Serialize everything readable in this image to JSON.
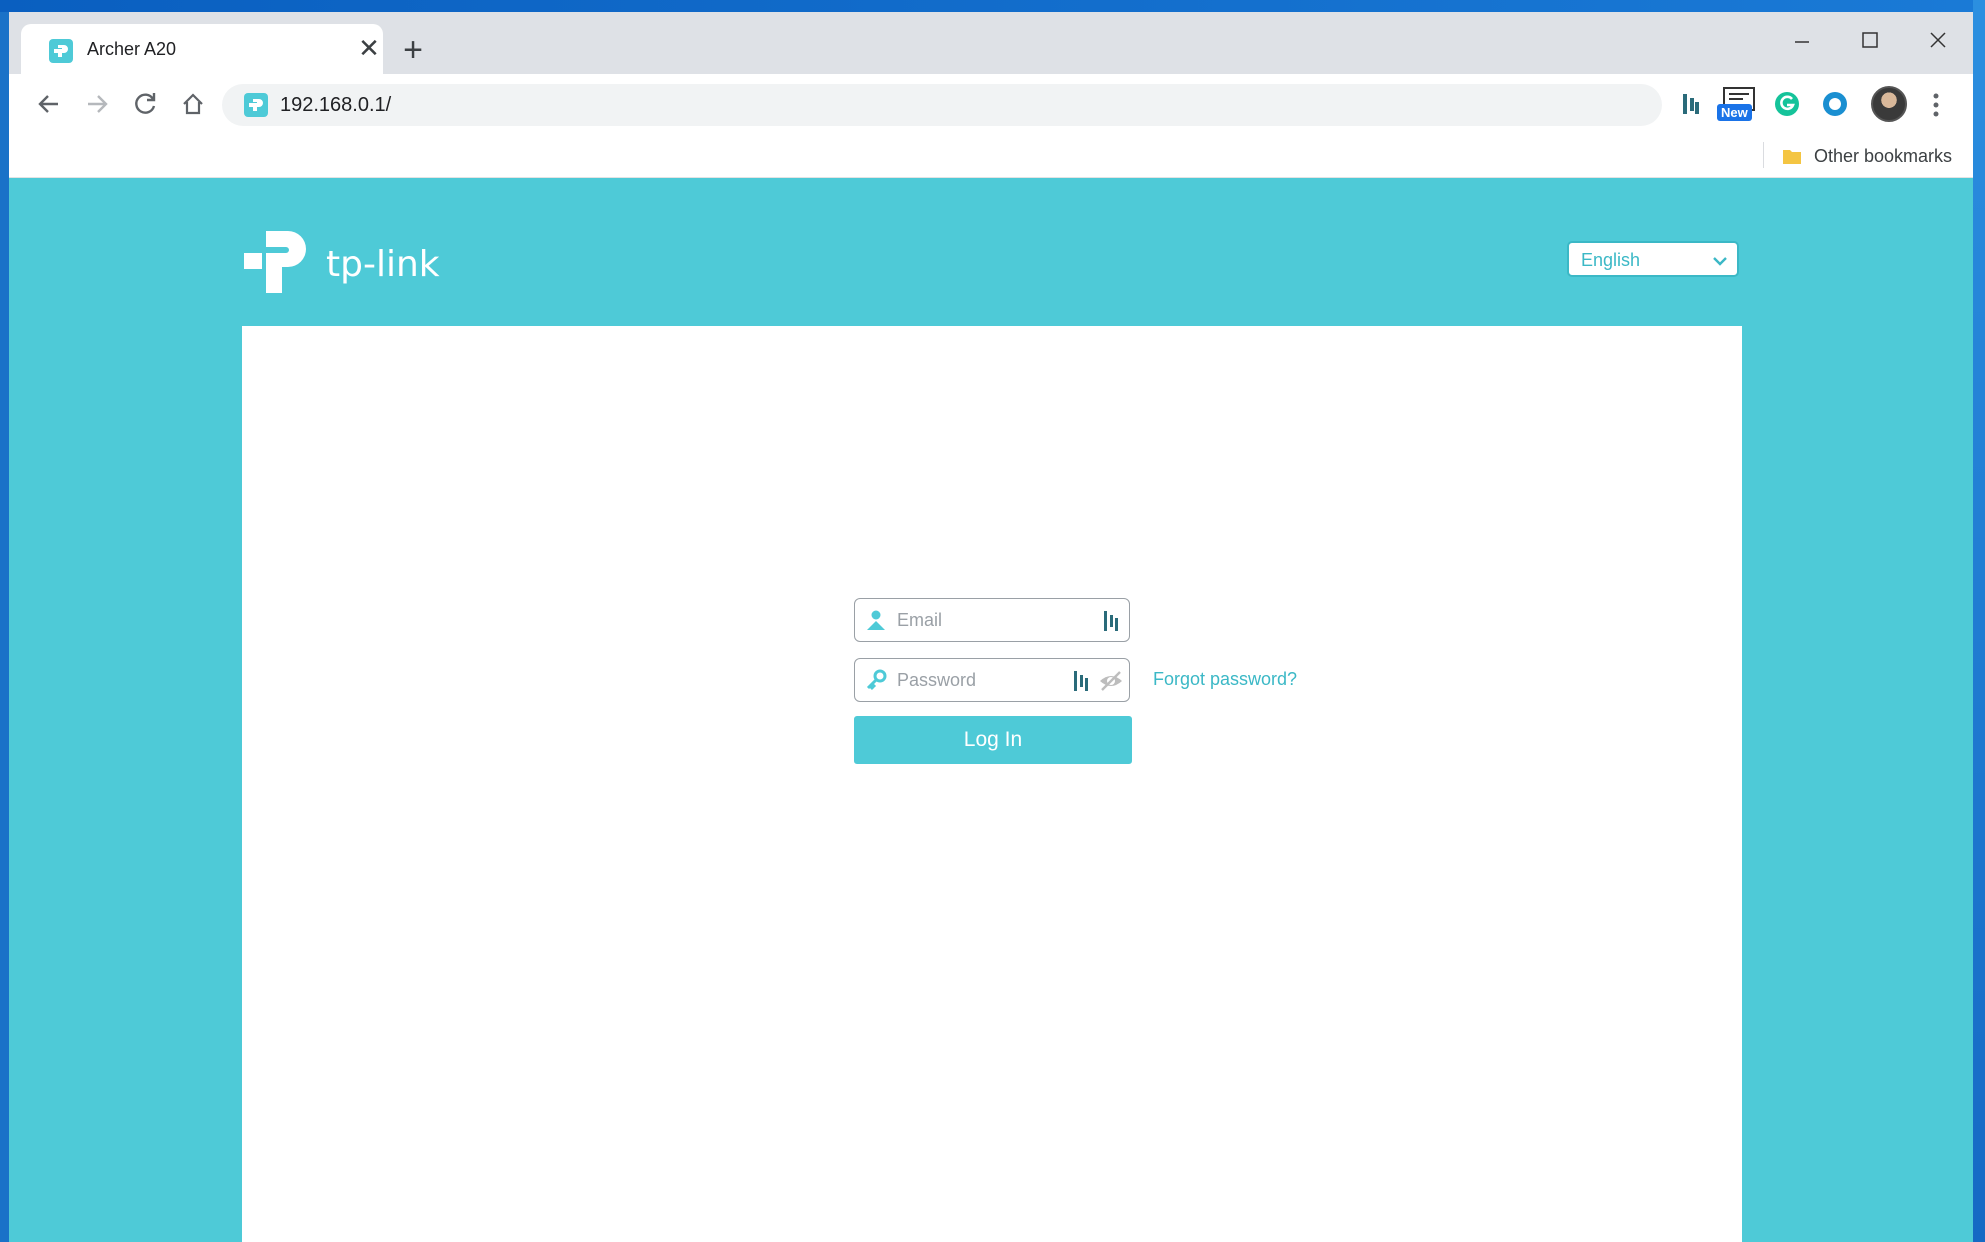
{
  "browser": {
    "tab": {
      "title": "Archer A20",
      "close_glyph": "✕"
    },
    "new_tab_glyph": "+",
    "address": {
      "url": "192.168.0.1/"
    },
    "extensions": {
      "new_badge": "New"
    },
    "bookmarks": {
      "other_label": "Other bookmarks"
    }
  },
  "router": {
    "brand": "tp-link",
    "language": {
      "selected": "English"
    },
    "login": {
      "email_placeholder": "Email",
      "password_placeholder": "Password",
      "forgot_label": "Forgot password?",
      "login_label": "Log In"
    }
  },
  "colors": {
    "brand_teal": "#4ecad7",
    "link_teal": "#3bb8c6"
  }
}
